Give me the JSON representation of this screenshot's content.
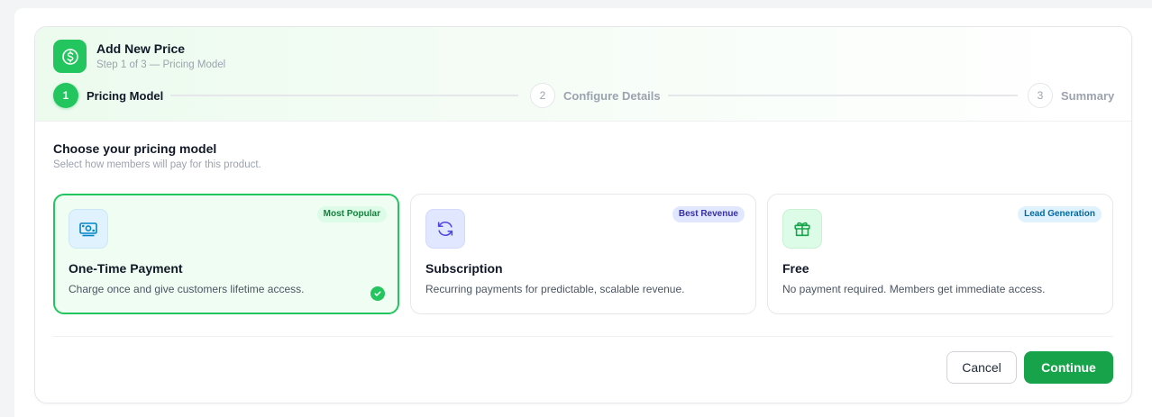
{
  "header": {
    "title": "Add New Price",
    "subtitle": "Step 1 of 3 — Pricing Model",
    "icon": "dollar-circle-icon"
  },
  "steps": [
    {
      "number": "1",
      "label": "Pricing Model",
      "state": "active"
    },
    {
      "number": "2",
      "label": "Configure Details",
      "state": "idle"
    },
    {
      "number": "3",
      "label": "Summary",
      "state": "idle"
    }
  ],
  "section": {
    "title": "Choose your pricing model",
    "subtitle": "Select how members will pay for this product."
  },
  "cards": [
    {
      "title": "One-Time Payment",
      "description": "Charge once and give customers lifetime access.",
      "badge": "Most Popular",
      "badge_color": "#15803d",
      "badge_bg": "#dcfce7",
      "icon": "banknote-icon",
      "icon_color": "#0284c7",
      "icon_bg": "#e0f2fe",
      "selected": true
    },
    {
      "title": "Subscription",
      "description": "Recurring payments for predictable, scalable revenue.",
      "badge": "Best Revenue",
      "badge_color": "#3730a3",
      "badge_bg": "#e0e7ff",
      "icon": "refresh-icon",
      "icon_color": "#4f46e5",
      "icon_bg": "#e0e7ff",
      "selected": false
    },
    {
      "title": "Free",
      "description": "No payment required. Members get immediate access.",
      "badge": "Lead Generation",
      "badge_color": "#0369a1",
      "badge_bg": "#e0f2fe",
      "icon": "gift-icon",
      "icon_color": "#16a34a",
      "icon_bg": "#dcfce7",
      "selected": false
    }
  ],
  "actions": {
    "cancel_label": "Cancel",
    "continue_label": "Continue"
  },
  "colors": {
    "accent": "#22c55e",
    "primary_button": "#16a34a"
  }
}
